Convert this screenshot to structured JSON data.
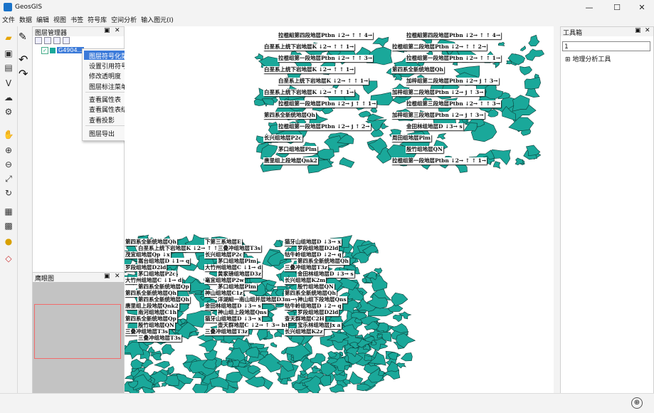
{
  "window": {
    "title": "GeosGIS",
    "min": "—",
    "max": "☐",
    "close": "✕"
  },
  "menubar": [
    "文件",
    "数据",
    "编辑",
    "视图",
    "书签",
    "符号库",
    "空间分析",
    "输入图元(I)"
  ],
  "layer_panel": {
    "title": "图层管理器",
    "pin": "▣",
    "close": "✕",
    "layer_name": "G4904...",
    "checked": "✓"
  },
  "context_menu": {
    "items": [
      "图层符号化菜单",
      "设置引用符号",
      "修改透明度",
      "图层标注菜单",
      "查看属性表",
      "查看属性表结构",
      "查看投影",
      "图层导出"
    ],
    "active_index": 0
  },
  "eagle_panel": {
    "title": "鹰眼图",
    "pin": "▣",
    "close": "✕"
  },
  "toolbox": {
    "title": "工具箱",
    "pin": "▣",
    "close": "✕",
    "input_value": "1",
    "tree_expander": "⊞",
    "tree_item": "地理分析工具"
  },
  "map": {
    "fill_color": "#1aa89a",
    "labels_top": [
      "拉棍組第四段地层Ptbn ↓2→ ↑ ↑ 4→",
      "拉棍組第四段地层Ptbn ↓2→ ↑ ↑ 4→",
      "白垩系上统下岩地层K ↓2→ ↑ ↑ 1→",
      "拉棍组第二段地层Ptbn ↓2→ ↑ ↑ 2→",
      "拉棍组第一段地层Ptbn ↓2→ ↑ ↑ 3→",
      "拉棍组第一段地层Ptbn ↓2→ ↑ ↑ 1→",
      "白垩系上统下岩地层K ↓2→ ↑ ↑ 1→",
      "第四系全新统地层Qh",
      "白垩系上统下岩地层K ↓2→ ↑ ↑ 1→",
      "加梓组第二段地层Ptbn ↓2→ j ↑ 3→",
      "白垩系上统下岩地层K ↓2→ ↑ ↑ 1→",
      "加梓组第二段地层Ptbn ↓2→ j ↑ 3→",
      "拉棍组第一段地层Ptbn ↓2→ j ↑ ↑ 1→",
      "拉棍组第三段地层Ptbn ↓2→ ↑ ↑ 3→",
      "第四系全新统地层Qh",
      "加梓组第三段地层Ptbn ↓2→ j ↑ 3→",
      "拉棍组第一段地层Ptbn ↓2→ j ↑ 2→",
      "金田林组地层D ↓3→ s",
      "长兴组地层P2c",
      "周田组地层Plm",
      "茅口组地层Plm",
      "殷竹组地层QN",
      "唐里组上段地层Qnk2",
      "拉棍组第一段地层Ptbn ↓2→ ↑ ↑ 1→"
    ],
    "labels_bottom": [
      "第四系全新统地层Qh",
      "下第三系地层E",
      "猫牙山组地层D ↓3→ x",
      "白垩系上统下岩地层K ↓2→ ↑ ↑",
      "三叠冲组地层T3s",
      "罗段组地层D2ld",
      "茂宜组地层Qp ↓x",
      "长兴组地层P2c",
      "牯牛岭组地层D ↓2→ q",
      "嵩台组地层D ↓1→ q",
      "茅口组地层Plm",
      "第四系全新统地层Qh",
      "罗段组地层D2ld",
      "大竹州组地层C ↓1→ d",
      "三叠冲组地层T3z",
      "茅口组地层P2c",
      "黄家磅组地层D3z",
      "金田林组地层D ↓3→ s",
      "大竹州组地层C ↓1→ d",
      "毫宜组地层P2w",
      "长兴组地层K2m",
      "第四系全新统地层Qp",
      "茅口组地层Plm",
      "殷竹组地层QN",
      "第四系全新统地层Qh",
      "神山组地层C1z",
      "第四系全新统地层Qh",
      "第四系全新统地层Qh",
      "洋湖組一南山组并层地层D3m→yh",
      "神山组下段地层Qns",
      "唐里组上段地层Qnk2",
      "金田林组地层D ↓3→ s",
      "牯牛岭组地层D ↓2→ q",
      "南河组地层C1h",
      "神山组上段地层Qns",
      "罗段组地层D2ld",
      "第四系全新统地层Qp",
      "猫牙山组地层D ↓3→ x",
      "查天群地层C2H",
      "殷竹组地层QN",
      "壶天群地层C ↓2→ ↑ 3→ ht",
      "宝乐林组地层Jx a",
      "三叠冲组地层T3s",
      "三叠冲组地层T3z",
      "长兴组地层K2z",
      "三叠冲组地层T3s"
    ]
  },
  "statusbar": {
    "globe": "⊕"
  }
}
